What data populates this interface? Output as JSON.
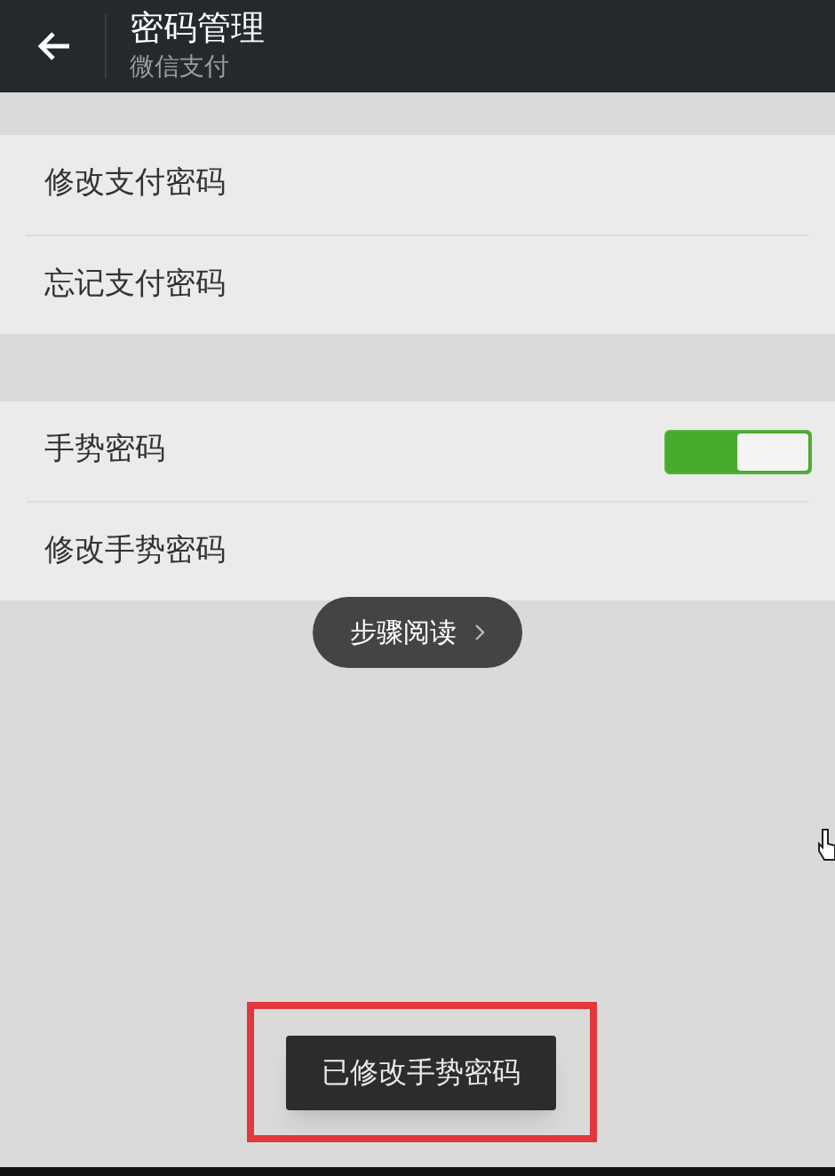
{
  "header": {
    "title": "密码管理",
    "subtitle": "微信支付"
  },
  "groups": [
    {
      "items": [
        {
          "kind": "link",
          "label": "修改支付密码"
        },
        {
          "kind": "link",
          "label": "忘记支付密码"
        }
      ]
    },
    {
      "items": [
        {
          "kind": "toggle",
          "label": "手势密码",
          "on": true
        },
        {
          "kind": "link",
          "label": "修改手势密码"
        }
      ]
    }
  ],
  "step_reading_button": {
    "label": "步骤阅读"
  },
  "toast": {
    "text": "已修改手势密码",
    "highlighted": true
  }
}
